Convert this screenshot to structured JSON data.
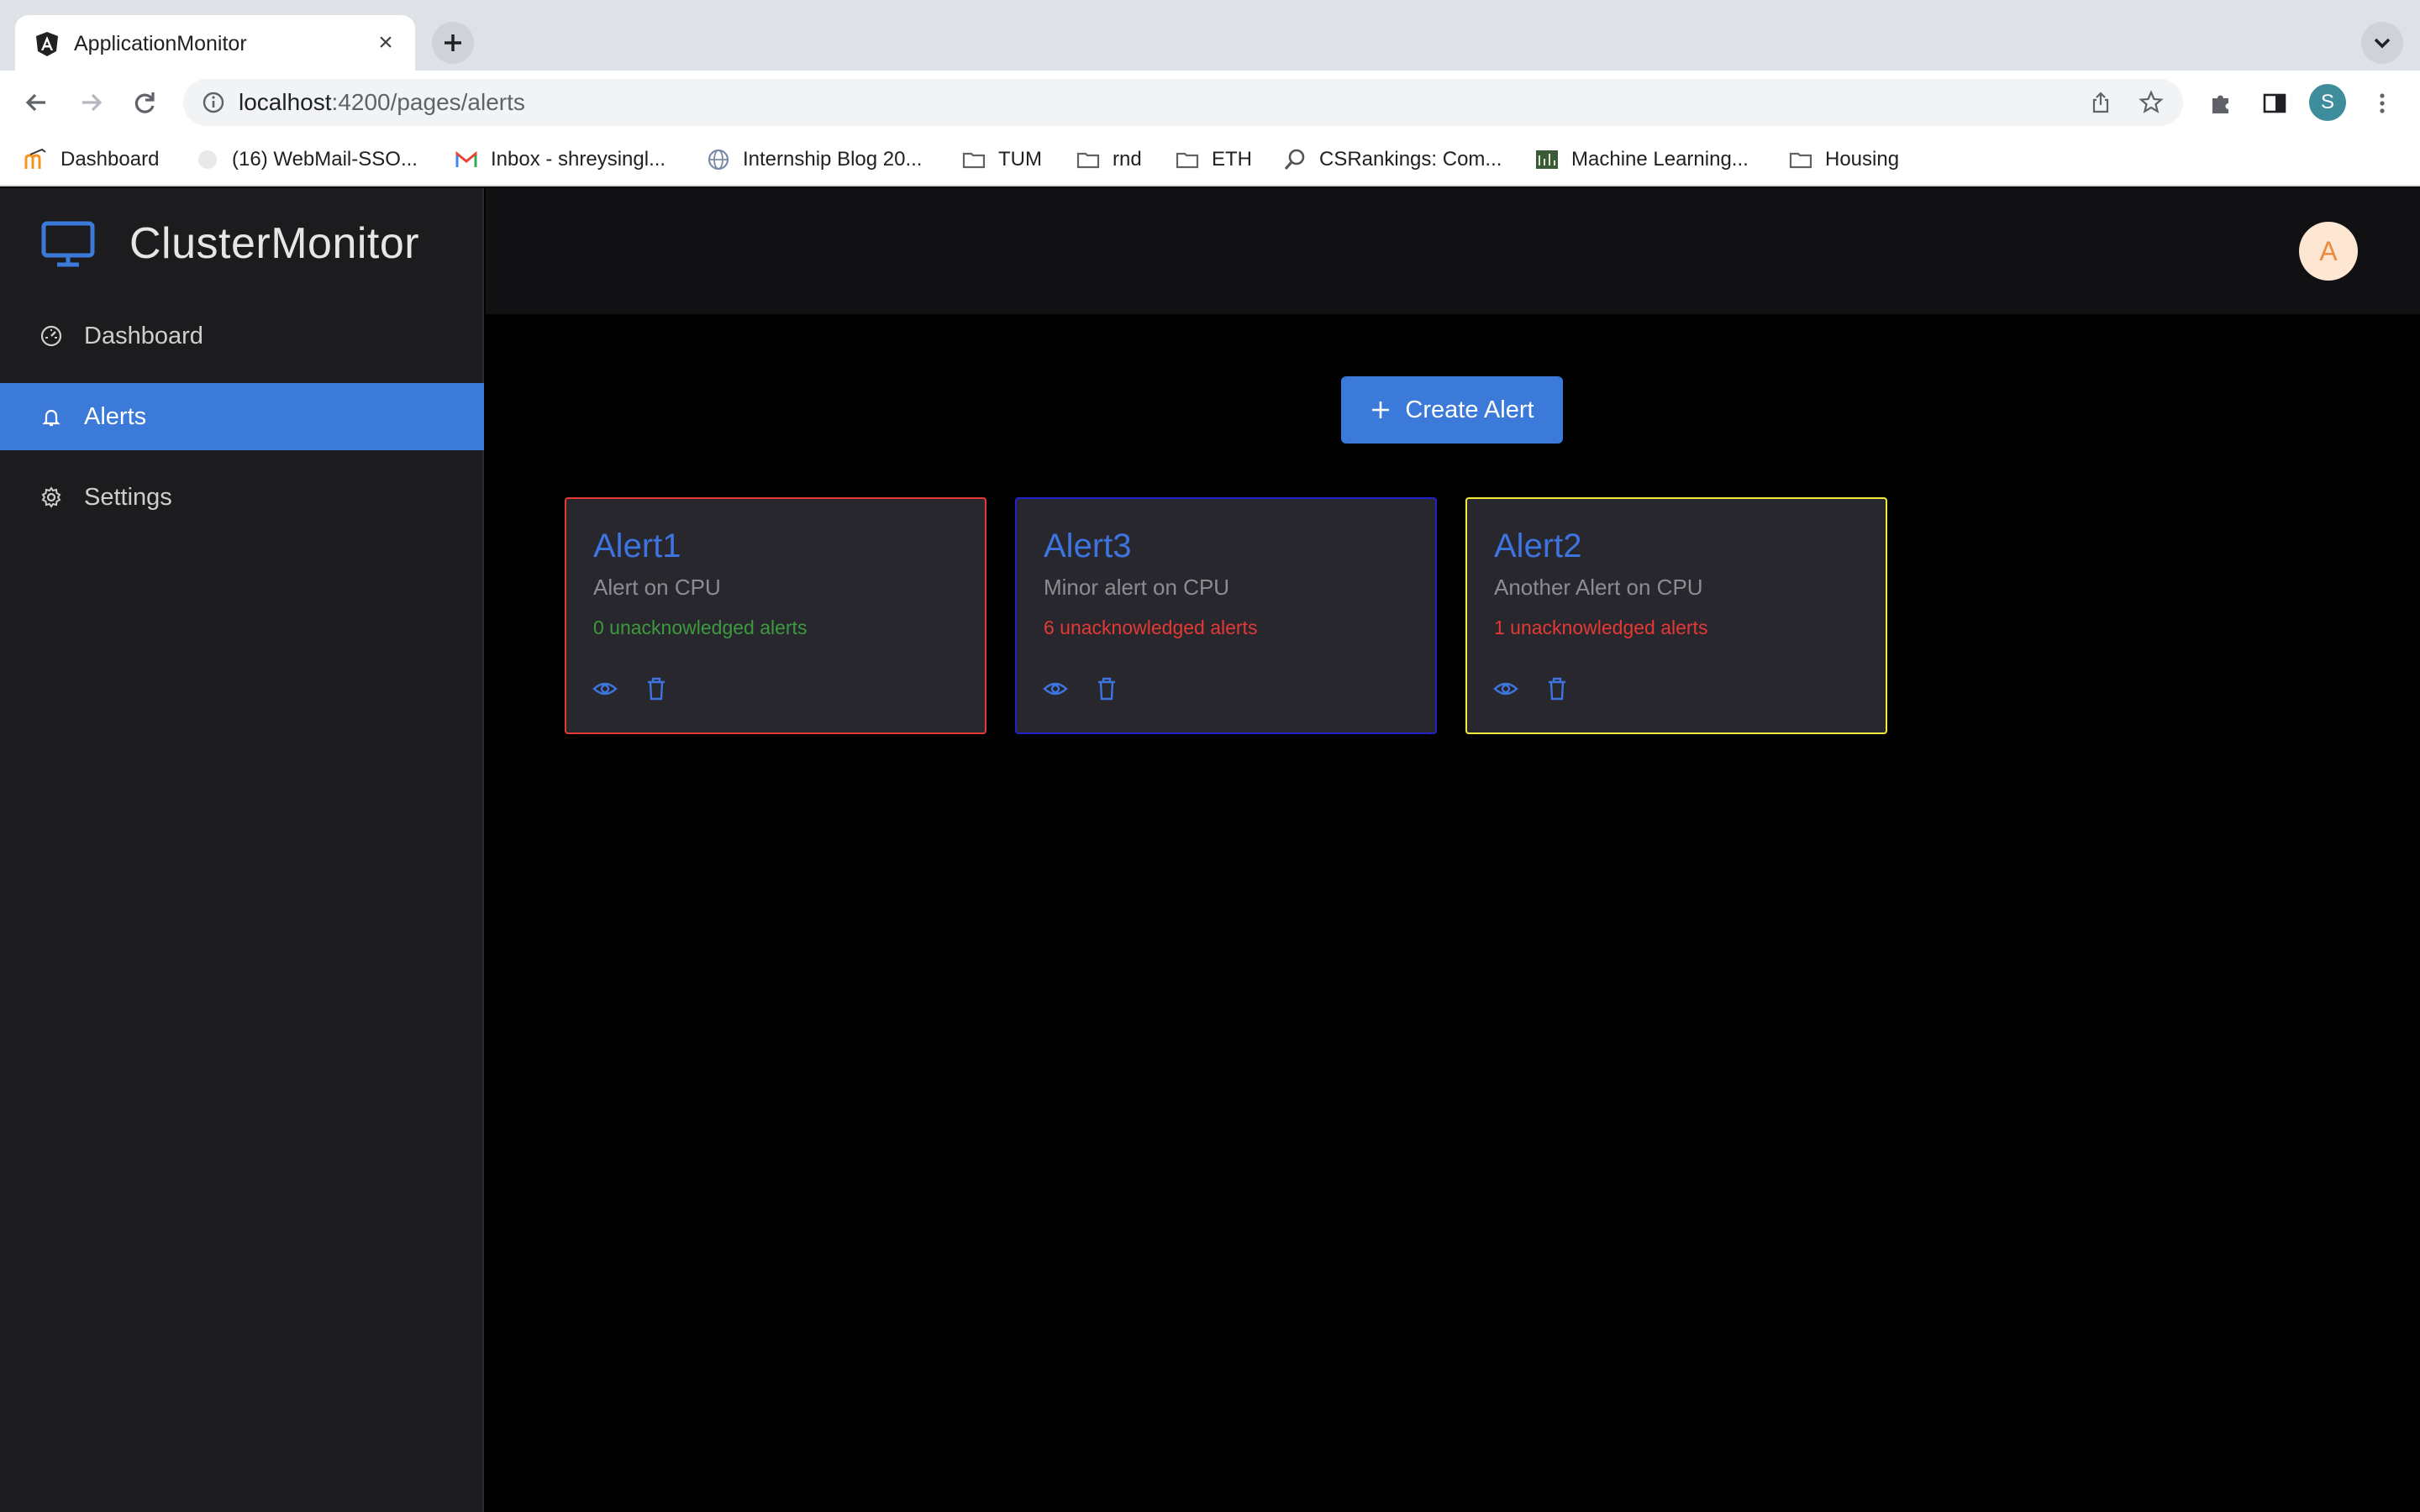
{
  "browser": {
    "tab_title": "ApplicationMonitor",
    "url_host": "localhost",
    "url_path": ":4200/pages/alerts",
    "profile_initial": "S",
    "bookmarks": [
      {
        "label": "Dashboard",
        "icon": "moodle-icon"
      },
      {
        "label": "(16) WebMail-SSO...",
        "icon": "webmail-icon"
      },
      {
        "label": "Inbox - shreysingl...",
        "icon": "gmail-icon"
      },
      {
        "label": "Internship Blog 20...",
        "icon": "globe-icon"
      },
      {
        "label": "TUM",
        "icon": "folder-icon"
      },
      {
        "label": "rnd",
        "icon": "folder-icon"
      },
      {
        "label": "ETH",
        "icon": "folder-icon"
      },
      {
        "label": "CSRankings: Com...",
        "icon": "search-icon"
      },
      {
        "label": "Machine Learning...",
        "icon": "ml-icon"
      },
      {
        "label": "Housing",
        "icon": "folder-icon"
      }
    ]
  },
  "app": {
    "brand": "ClusterMonitor",
    "user_initial": "A",
    "nav": [
      {
        "label": "Dashboard",
        "icon": "dashboard-icon",
        "active": false
      },
      {
        "label": "Alerts",
        "icon": "bell-icon",
        "active": true
      },
      {
        "label": "Settings",
        "icon": "gear-icon",
        "active": false
      }
    ],
    "create_button": "Create Alert",
    "alerts": [
      {
        "title": "Alert1",
        "description": "Alert on CPU",
        "count_text": "0 unacknowledged alerts",
        "border": "#e53935",
        "count_color": "#3f9a3f"
      },
      {
        "title": "Alert3",
        "description": "Minor alert on CPU",
        "count_text": "6 unacknowledged alerts",
        "border": "#2222c8",
        "count_color": "#e53935"
      },
      {
        "title": "Alert2",
        "description": "Another Alert on CPU",
        "count_text": "1 unacknowledged alerts",
        "border": "#f2ea3a",
        "count_color": "#e53935"
      }
    ]
  },
  "colors": {
    "accent": "#3b7ad8",
    "sidebar_bg": "#1c1c1f",
    "card_bg": "#27272d"
  }
}
